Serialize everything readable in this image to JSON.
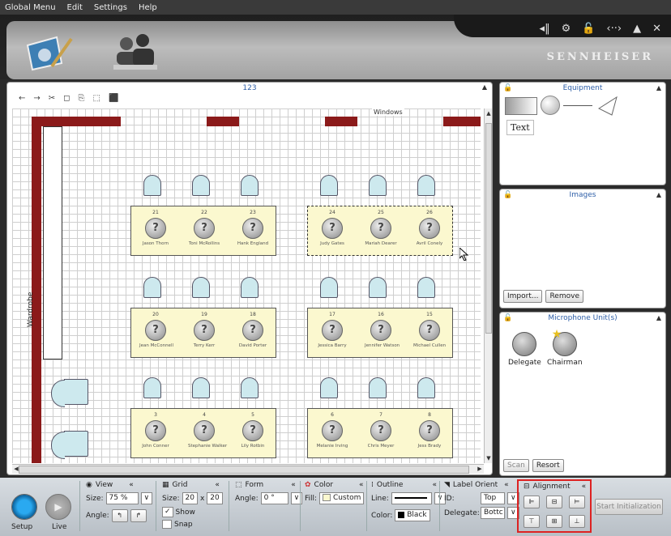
{
  "menu": [
    "Global Menu",
    "Edit",
    "Settings",
    "Help"
  ],
  "brand": "SENNHEISER",
  "window_controls": [
    "◂‖",
    "⚙",
    "🔓",
    "‹··›",
    "▲",
    "✕"
  ],
  "canvas": {
    "title": "123",
    "window_label": "Windows",
    "wardrobe_label": "Wardrobe",
    "tool_icons": [
      "←",
      "→",
      "✂",
      "◻",
      "⎘",
      "⬚",
      "⬛"
    ]
  },
  "seat_icon": "?",
  "tables": [
    {
      "seats": [
        {
          "num": "21",
          "name": "Jason Thorn"
        },
        {
          "num": "22",
          "name": "Toni McRollins"
        },
        {
          "num": "23",
          "name": "Hank England"
        }
      ]
    },
    {
      "seats": [
        {
          "num": "24",
          "name": "Judy Gates"
        },
        {
          "num": "25",
          "name": "Mariah Dearer"
        },
        {
          "num": "26",
          "name": "Avril Conely"
        }
      ]
    },
    {
      "seats": [
        {
          "num": "20",
          "name": "Jean McConnell"
        },
        {
          "num": "19",
          "name": "Terry Kerr"
        },
        {
          "num": "18",
          "name": "David Porter"
        }
      ]
    },
    {
      "seats": [
        {
          "num": "17",
          "name": "Jessica Barry"
        },
        {
          "num": "16",
          "name": "Jennifer Watson"
        },
        {
          "num": "15",
          "name": "Michael Cullen"
        }
      ]
    },
    {
      "seats": [
        {
          "num": "3",
          "name": "John Conner"
        },
        {
          "num": "4",
          "name": "Stephanie Walker"
        },
        {
          "num": "5",
          "name": "Lily Rotbin"
        }
      ]
    },
    {
      "seats": [
        {
          "num": "6",
          "name": "Melanie Irving"
        },
        {
          "num": "7",
          "name": "Chris Meyer"
        },
        {
          "num": "8",
          "name": "Jess Brady"
        }
      ]
    }
  ],
  "equipment": {
    "title": "Equipment",
    "text_item": "Text"
  },
  "images": {
    "title": "Images",
    "import": "Import...",
    "remove": "Remove"
  },
  "mics": {
    "title": "Microphone Unit(s)",
    "delegate": "Delegate",
    "chairman": "Chairman",
    "scan": "Scan",
    "resort": "Resort"
  },
  "bottom": {
    "setup": "Setup",
    "live": "Live",
    "view": {
      "title": "View",
      "size_label": "Size:",
      "size_value": "75 %",
      "angle_label": "Angle:"
    },
    "grid": {
      "title": "Grid",
      "size_label": "Size:",
      "w": "20",
      "x": "x",
      "h": "20",
      "show": "Show",
      "snap": "Snap"
    },
    "form": {
      "title": "Form",
      "angle_label": "Angle:",
      "angle_value": "0 °"
    },
    "color": {
      "title": "Color",
      "fill_label": "Fill:",
      "fill_value": "Custom"
    },
    "outline": {
      "title": "Outline",
      "line_label": "Line:",
      "color_label": "Color:",
      "color_value": "Black"
    },
    "label_orient": {
      "title": "Label Orient",
      "id_label": "ID:",
      "id_value": "Top",
      "delegate_label": "Delegate:",
      "delegate_value": "Bottc"
    },
    "alignment": {
      "title": "Alignment"
    },
    "start": "Start Initialization"
  }
}
